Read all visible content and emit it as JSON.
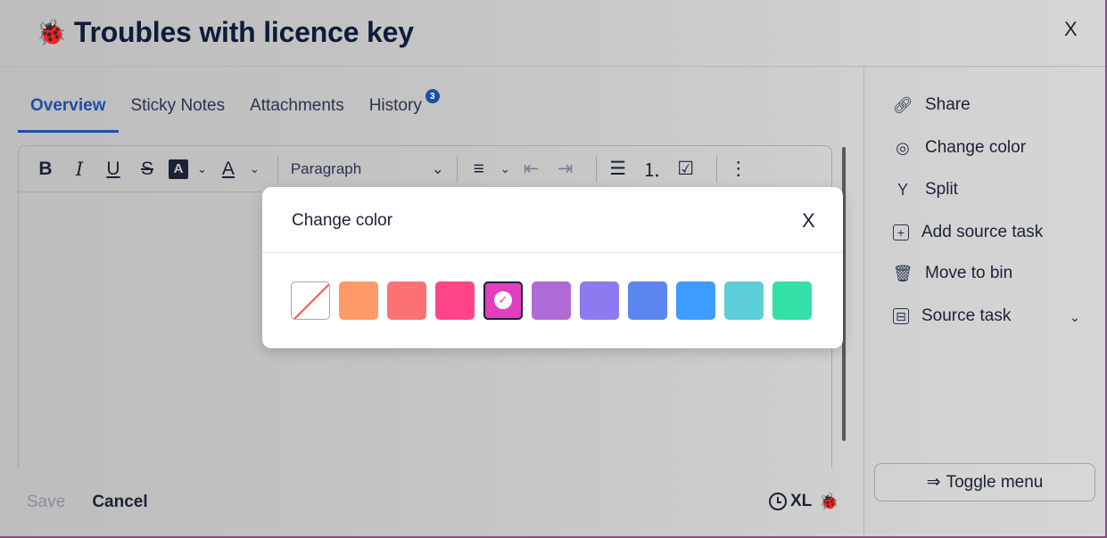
{
  "header": {
    "title": "Troubles with licence key",
    "bug_icon": "ladybug-icon",
    "close_label": "X"
  },
  "tabs": [
    {
      "label": "Overview",
      "active": true
    },
    {
      "label": "Sticky Notes",
      "active": false
    },
    {
      "label": "Attachments",
      "active": false
    },
    {
      "label": "History",
      "active": false,
      "badge": "3"
    }
  ],
  "toolbar": {
    "bold": "B",
    "italic": "I",
    "underline": "U",
    "strike": "S",
    "highlight": "A",
    "font_color": "A",
    "paragraph": "Paragraph",
    "caret": "⌄"
  },
  "footer": {
    "save_label": "Save",
    "cancel_label": "Cancel",
    "estimate": "XL"
  },
  "sidebar": {
    "items": [
      {
        "label": "Share",
        "icon": "link-icon"
      },
      {
        "label": "Change color",
        "icon": "palette-icon"
      },
      {
        "label": "Split",
        "icon": "split-icon"
      },
      {
        "label": "Add source task",
        "icon": "plus-box-icon"
      },
      {
        "label": "Move to bin",
        "icon": "trash-icon"
      },
      {
        "label": "Source task",
        "icon": "source-task-icon"
      }
    ],
    "toggle_label": "Toggle menu"
  },
  "modal": {
    "title": "Change color",
    "close_label": "X",
    "swatches": [
      {
        "color": "none"
      },
      {
        "color": "#ff9966"
      },
      {
        "color": "#fc7272"
      },
      {
        "color": "#ff4488"
      },
      {
        "color": "#e23fbd",
        "selected": true
      },
      {
        "color": "#b06ad6"
      },
      {
        "color": "#8d7af0"
      },
      {
        "color": "#5b86ef"
      },
      {
        "color": "#3d9cff"
      },
      {
        "color": "#5ccfd8"
      },
      {
        "color": "#33e0a8"
      }
    ]
  },
  "colors": {
    "accent": "#1d4ea8",
    "text": "#1b2236"
  }
}
